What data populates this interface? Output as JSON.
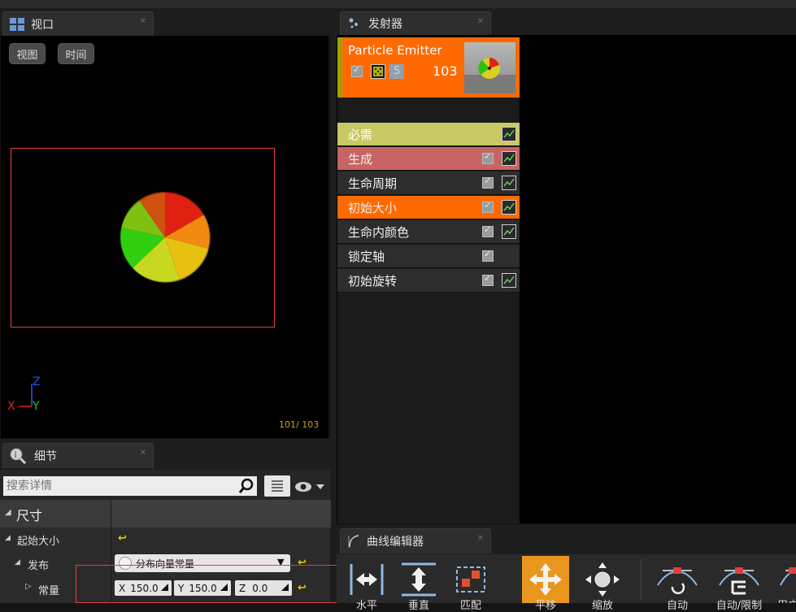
{
  "viewport": {
    "tab_title": "视口",
    "view_button": "视图",
    "time_button": "时间",
    "axis_z": "Z",
    "axis_x": "X",
    "axis_y": "Y",
    "particle_count": "101/ 103"
  },
  "emitters": {
    "tab_title": "发射器",
    "emitter_name": "Particle Emitter",
    "solo_label": "S",
    "count": "103",
    "modules": [
      {
        "label": "必需",
        "color": "#c8c864",
        "checkbox": false,
        "graph": true
      },
      {
        "label": "生成",
        "color": "#c86464",
        "checkbox": true,
        "graph": true
      },
      {
        "label": "生命周期",
        "color": "#2d2d2d",
        "checkbox": true,
        "graph": true
      },
      {
        "label": "初始大小",
        "color": "#ff6a00",
        "checkbox": true,
        "graph": true
      },
      {
        "label": "生命内颜色",
        "color": "#2d2d2d",
        "checkbox": true,
        "graph": true
      },
      {
        "label": "锁定轴",
        "color": "#2d2d2d",
        "checkbox": true,
        "graph": false
      },
      {
        "label": "初始旋转",
        "color": "#2d2d2d",
        "checkbox": true,
        "graph": true
      }
    ]
  },
  "details": {
    "tab_title": "细节",
    "search_placeholder": "搜索详情",
    "category": "尺寸",
    "prop_start_size": "起始大小",
    "prop_distribution": "发布",
    "distribution_value": "分布向量常量",
    "prop_constant": "常量",
    "x_label": "X",
    "x_value": "150.0",
    "y_label": "Y",
    "y_value": "150.0",
    "z_label": "Z",
    "z_value": "0.0"
  },
  "curve_editor": {
    "tab_title": "曲线编辑器",
    "tools": [
      "水平",
      "垂直",
      "匹配",
      "平移",
      "缩放",
      "自动",
      "自动/限制",
      "用户"
    ]
  },
  "colors": {
    "accent_orange": "#ff6a00",
    "selection_red": "#e04040",
    "emitter_yellow_bar": "#a0a000"
  }
}
